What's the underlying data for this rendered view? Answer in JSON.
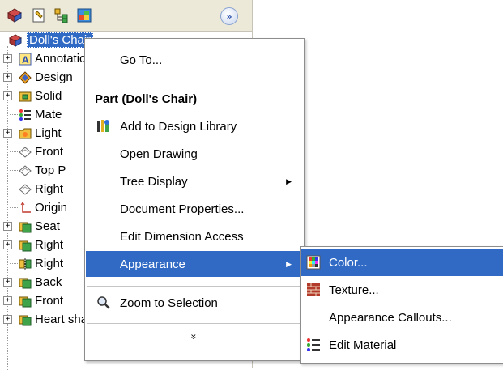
{
  "toolbar": {
    "buttons": [
      "feature-manager-icon",
      "property-manager-icon",
      "configuration-manager-icon",
      "display-manager-icon"
    ],
    "expand_label": "»"
  },
  "tree": {
    "root": "Doll's Chair",
    "items": [
      {
        "label": "Annotations",
        "icon": "annotations-icon",
        "expandable": true
      },
      {
        "label": "Design",
        "icon": "design-binder-icon",
        "expandable": true
      },
      {
        "label": "Solid",
        "icon": "solid-bodies-icon",
        "expandable": true
      },
      {
        "label": "Mate",
        "icon": "material-icon",
        "expandable": false
      },
      {
        "label": "Light",
        "icon": "lights-folder-icon",
        "expandable": true
      },
      {
        "label": "Front",
        "icon": "plane-icon",
        "expandable": false
      },
      {
        "label": "Top P",
        "icon": "plane-icon",
        "expandable": false
      },
      {
        "label": "Right",
        "icon": "plane-icon",
        "expandable": false
      },
      {
        "label": "Origin",
        "icon": "origin-icon",
        "expandable": false
      },
      {
        "label": "Seat",
        "icon": "feature-icon",
        "expandable": true
      },
      {
        "label": "Right",
        "icon": "feature-icon",
        "expandable": true
      },
      {
        "label": "Right",
        "icon": "mirror-feature-icon",
        "expandable": false
      },
      {
        "label": "Back",
        "icon": "feature-icon",
        "expandable": true
      },
      {
        "label": "Front",
        "icon": "feature-icon",
        "expandable": true
      },
      {
        "label": "Heart shape",
        "icon": "feature-icon",
        "expandable": true
      }
    ]
  },
  "context_menu": {
    "goto": "Go To...",
    "header": "Part (Doll's Chair)",
    "add_to_design_library": "Add to Design Library",
    "open_drawing": "Open Drawing",
    "tree_display": "Tree Display",
    "document_properties": "Document Properties...",
    "edit_dimension_access": "Edit Dimension Access",
    "appearance": "Appearance",
    "zoom_to_selection": "Zoom to Selection",
    "more": "»"
  },
  "submenu": {
    "color": "Color...",
    "texture": "Texture...",
    "appearance_callouts": "Appearance Callouts...",
    "edit_material": "Edit Material"
  },
  "colors": {
    "highlight": "#316ac5",
    "toolbar_bg": "#ece9d8"
  }
}
